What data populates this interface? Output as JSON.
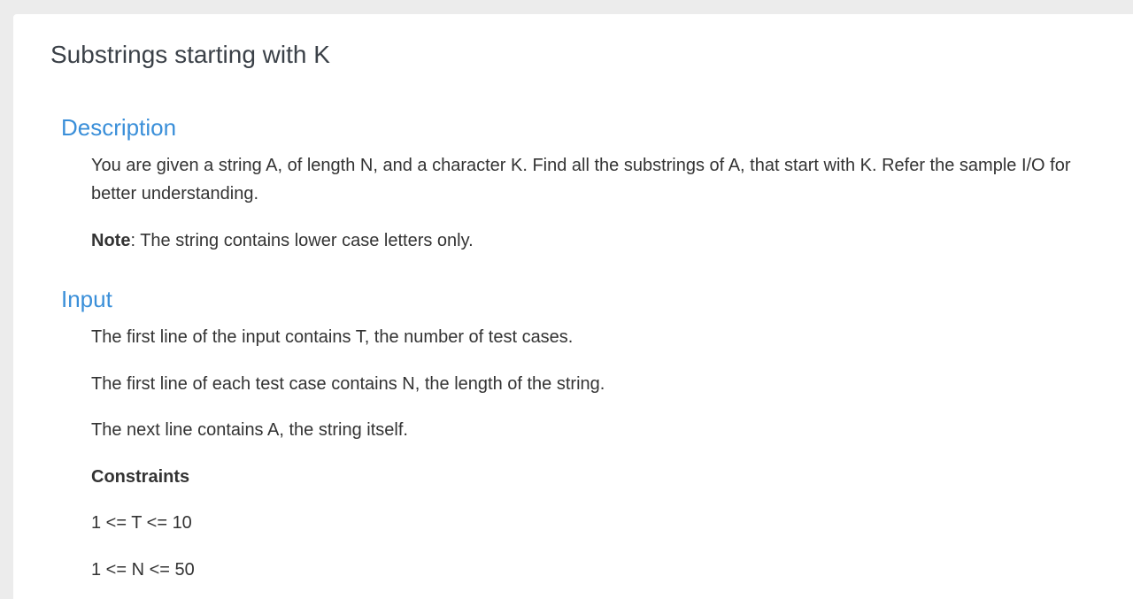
{
  "problem": {
    "title": "Substrings starting with K"
  },
  "description": {
    "heading": "Description",
    "text": "You are given a string A, of length N, and a character K. Find all the substrings of A, that start with K. Refer the sample I/O for better understanding.",
    "note_label": "Note",
    "note_text": ": The string contains lower case letters only."
  },
  "input": {
    "heading": "Input",
    "lines": [
      "The first line of the input contains T, the number of test cases.",
      "The first line of each test case contains N, the length of the string.",
      "The next line contains A, the string itself."
    ],
    "constraints_label": "Constraints",
    "constraints": [
      "1 <= T <= 10",
      "1 <= N <= 50"
    ]
  }
}
